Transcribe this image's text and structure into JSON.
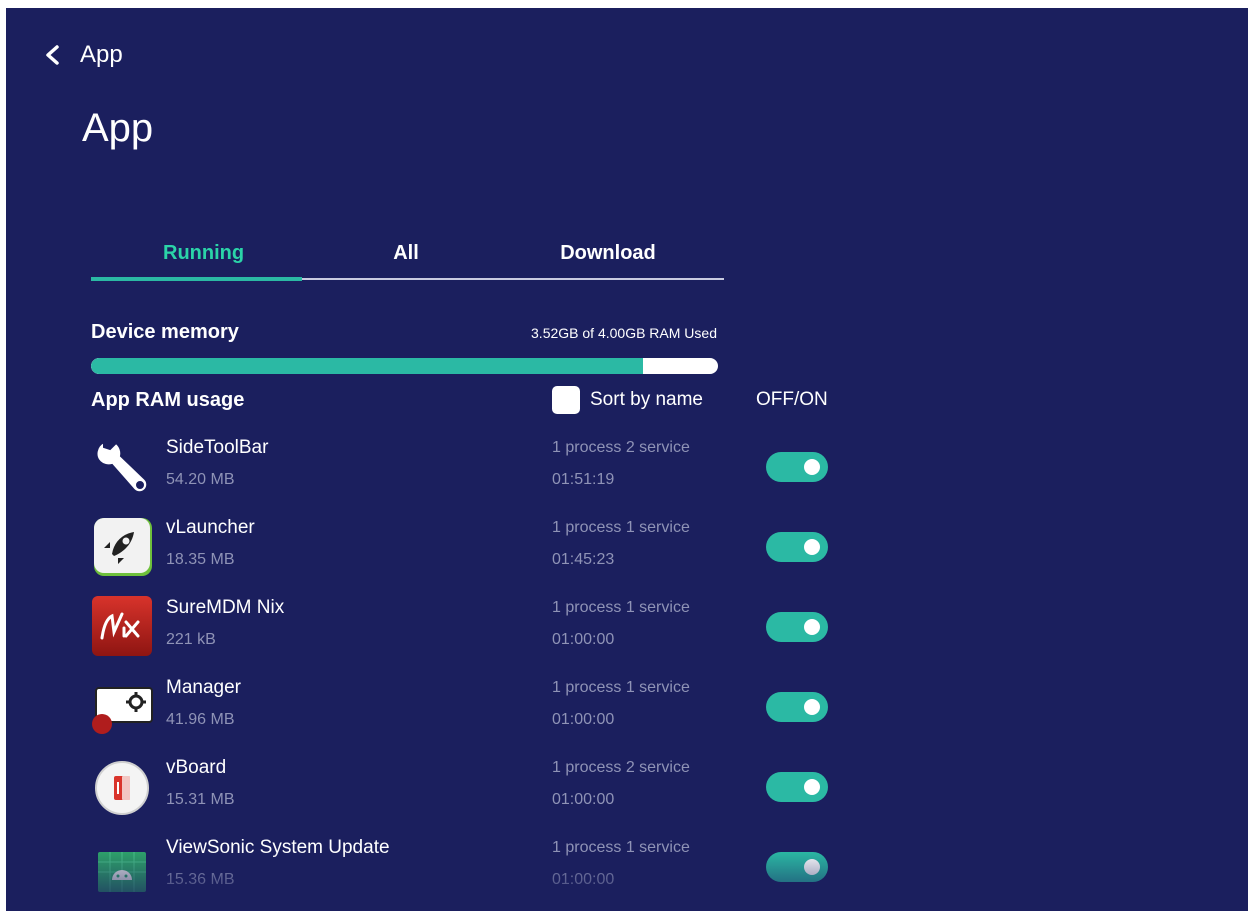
{
  "header": {
    "back_label": "App",
    "title": "App"
  },
  "tabs": [
    {
      "label": "Running",
      "active": true
    },
    {
      "label": "All",
      "active": false
    },
    {
      "label": "Download",
      "active": false
    }
  ],
  "memory": {
    "label": "Device memory",
    "used_text": "3.52GB of 4.00GB RAM Used",
    "used_fraction": 0.88
  },
  "ram_usage": {
    "label": "App RAM usage",
    "sort_label": "Sort by name",
    "sort_checked": false,
    "toggle_header": "OFF/ON"
  },
  "apps": [
    {
      "name": "SideToolBar",
      "size": "54.20 MB",
      "processes": "1 process 2 service",
      "time": "01:51:19",
      "on": true,
      "icon": "wrench-icon"
    },
    {
      "name": "vLauncher",
      "size": "18.35 MB",
      "processes": "1 process 1 service",
      "time": "01:45:23",
      "on": true,
      "icon": "rocket-icon"
    },
    {
      "name": "SureMDM Nix",
      "size": "221 kB",
      "processes": "1 process 1 service",
      "time": "01:00:00",
      "on": true,
      "icon": "nix-icon"
    },
    {
      "name": "Manager",
      "size": "41.96 MB",
      "processes": "1 process 1 service",
      "time": "01:00:00",
      "on": true,
      "icon": "gear-icon"
    },
    {
      "name": "vBoard",
      "size": "15.31 MB",
      "processes": "1 process 2 service",
      "time": "01:00:00",
      "on": true,
      "icon": "vboard-icon"
    },
    {
      "name": "ViewSonic System Update",
      "size": "15.36 MB",
      "processes": "1 process 1 service",
      "time": "01:00:00",
      "on": true,
      "icon": "android-icon"
    }
  ],
  "colors": {
    "background": "#1b1f5e",
    "accent": "#2bb9a4",
    "active_tab": "#2bd4a8",
    "secondary_text": "#8f93b6"
  }
}
